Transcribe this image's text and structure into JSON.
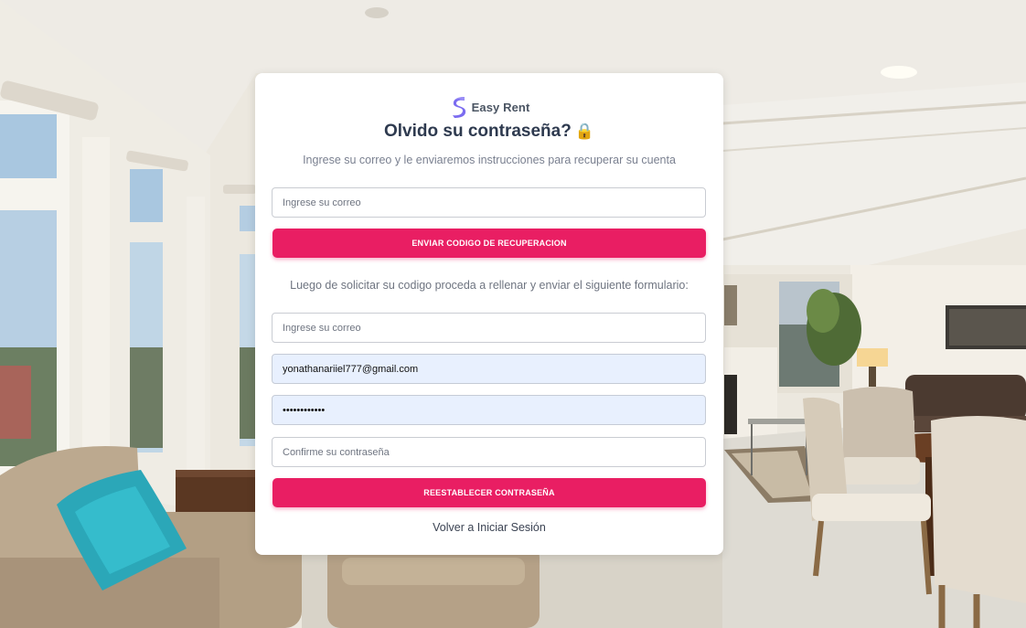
{
  "brand": {
    "name": "Easy Rent",
    "logo_icon": "s-logo-icon",
    "logo_color": "#7b6cf0"
  },
  "page": {
    "title": "Olvido su contraseña?",
    "title_icon": "🔒",
    "subtitle": "Ingrese su correo y le enviaremos instrucciones para recuperar su cuenta"
  },
  "request_form": {
    "email_placeholder": "Ingrese su correo",
    "email_value": "",
    "send_button": "ENVIAR CODIGO DE RECUPERACION"
  },
  "reset_form": {
    "instructions": "Luego de solicitar su codigo proceda a rellenar y enviar el siguiente formulario:",
    "email_placeholder": "Ingrese su correo",
    "code_value": "yonathanariiel777@gmail.com",
    "password_value": "••••••••••••",
    "confirm_placeholder": "Confirme su contraseña",
    "reset_button": "REESTABLECER CONTRASEÑA",
    "back_link": "Volver a Iniciar Sesión"
  },
  "colors": {
    "accent": "#e91e63",
    "autofill": "#e8f0fe"
  }
}
